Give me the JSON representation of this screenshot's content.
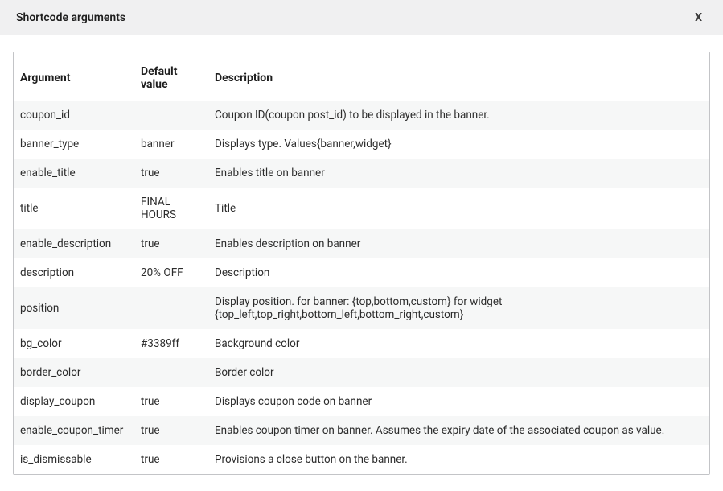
{
  "header": {
    "title": "Shortcode arguments",
    "close_label": "X"
  },
  "table": {
    "headers": {
      "argument": "Argument",
      "default": "Default value",
      "description": "Description"
    },
    "rows": [
      {
        "argument": "coupon_id",
        "default": "",
        "description": "Coupon ID(coupon post_id) to be displayed in the banner."
      },
      {
        "argument": "banner_type",
        "default": "banner",
        "description": "Displays type. Values{banner,widget}"
      },
      {
        "argument": "enable_title",
        "default": "true",
        "description": "Enables title on banner"
      },
      {
        "argument": "title",
        "default": "FINAL HOURS",
        "description": "Title"
      },
      {
        "argument": "enable_description",
        "default": "true",
        "description": "Enables description on banner"
      },
      {
        "argument": "description",
        "default": "20% OFF",
        "description": "Description"
      },
      {
        "argument": "position",
        "default": "",
        "description": "Display position. for banner: {top,bottom,custom} for widget {top_left,top_right,bottom_left,bottom_right,custom}"
      },
      {
        "argument": "bg_color",
        "default": "#3389ff",
        "description": "Background color"
      },
      {
        "argument": "border_color",
        "default": "",
        "description": "Border color"
      },
      {
        "argument": "display_coupon",
        "default": "true",
        "description": "Displays coupon code on banner"
      },
      {
        "argument": "enable_coupon_timer",
        "default": "true",
        "description": "Enables coupon timer on banner. Assumes the expiry date of the associated coupon as value."
      },
      {
        "argument": "is_dismissable",
        "default": "true",
        "description": "Provisions a close button on the banner."
      }
    ]
  }
}
